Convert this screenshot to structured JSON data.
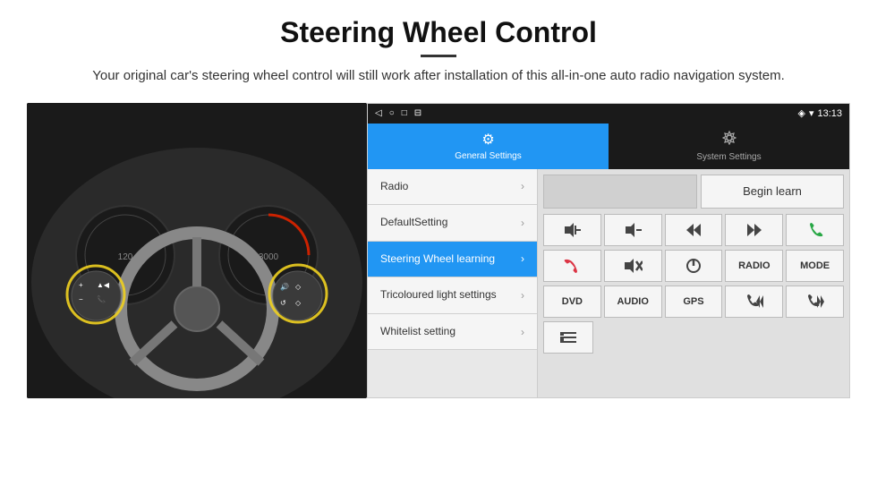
{
  "header": {
    "title": "Steering Wheel Control",
    "divider": true,
    "subtitle": "Your original car's steering wheel control will still work after installation of this all-in-one auto radio navigation system."
  },
  "status_bar": {
    "nav_back": "◁",
    "nav_home": "○",
    "nav_recent": "□",
    "nav_screenshot": "⊟",
    "location_icon": "◈",
    "wifi_icon": "▾",
    "time": "13:13"
  },
  "tabs": [
    {
      "id": "general",
      "label": "General Settings",
      "active": true,
      "icon": "⚙"
    },
    {
      "id": "system",
      "label": "System Settings",
      "active": false,
      "icon": "🌐"
    }
  ],
  "menu": {
    "items": [
      {
        "id": "radio",
        "label": "Radio",
        "active": false
      },
      {
        "id": "default",
        "label": "DefaultSetting",
        "active": false
      },
      {
        "id": "steering",
        "label": "Steering Wheel learning",
        "active": true
      },
      {
        "id": "tricoloured",
        "label": "Tricoloured light settings",
        "active": false
      },
      {
        "id": "whitelist",
        "label": "Whitelist setting",
        "active": false
      }
    ]
  },
  "right_panel": {
    "begin_learn_label": "Begin learn",
    "controls": {
      "row1": [
        {
          "id": "vol_up",
          "symbol": "🔊+",
          "unicode": "🔊"
        },
        {
          "id": "vol_down",
          "symbol": "🔊-",
          "unicode": "🔊"
        },
        {
          "id": "prev_track",
          "symbol": "⏮",
          "unicode": "⏮"
        },
        {
          "id": "next_track",
          "symbol": "⏭",
          "unicode": "⏭"
        },
        {
          "id": "phone",
          "symbol": "📞",
          "unicode": "📞"
        }
      ],
      "row2": [
        {
          "id": "hang_up",
          "symbol": "📵",
          "unicode": "📵"
        },
        {
          "id": "mute",
          "symbol": "🔇×",
          "unicode": "🔇"
        },
        {
          "id": "power",
          "symbol": "⏻",
          "unicode": "⏻"
        },
        {
          "id": "radio_btn",
          "label": "RADIO"
        },
        {
          "id": "mode_btn",
          "label": "MODE"
        }
      ],
      "row3": [
        {
          "id": "dvd_btn",
          "label": "DVD"
        },
        {
          "id": "audio_btn",
          "label": "AUDIO"
        },
        {
          "id": "gps_btn",
          "label": "GPS"
        },
        {
          "id": "tel_prev",
          "symbol": "📞⏮",
          "unicode": "📞⏮"
        },
        {
          "id": "tel_next",
          "symbol": "📞⏭",
          "unicode": "📞⏭"
        }
      ],
      "row4": [
        {
          "id": "list_icon",
          "symbol": "☰"
        }
      ]
    }
  }
}
